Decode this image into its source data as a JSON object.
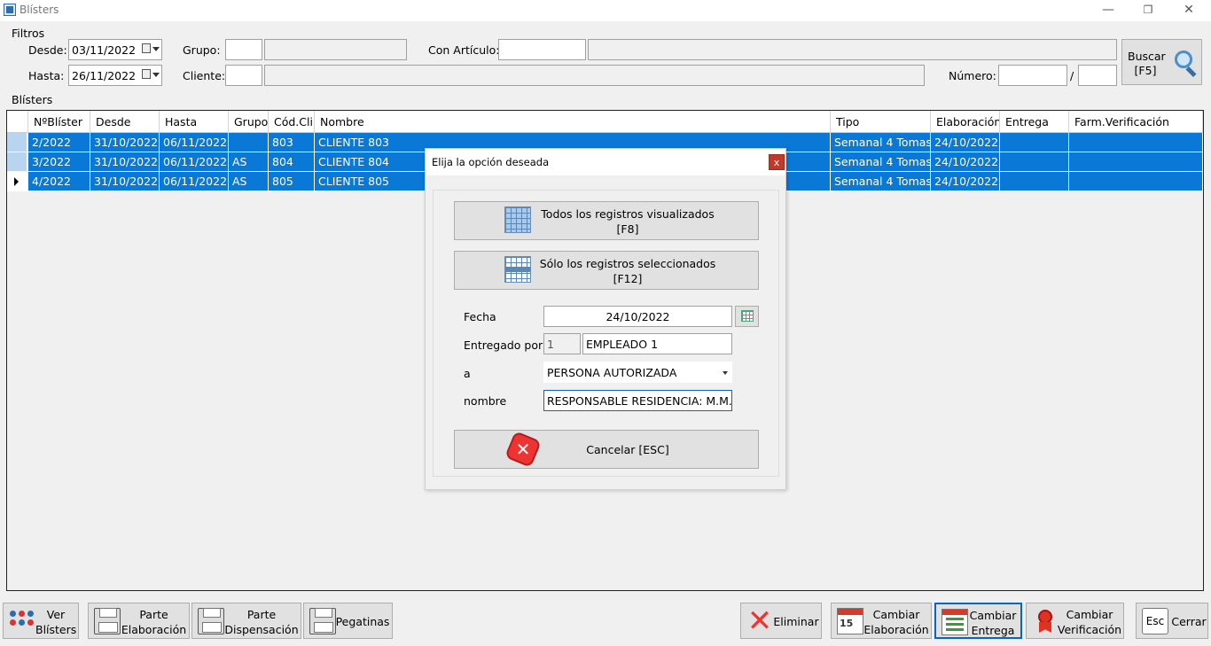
{
  "window": {
    "title": "Blísters",
    "minimize": "—",
    "restore": "❐",
    "close": "✕"
  },
  "filters": {
    "group_label": "Filtros",
    "desde_label": "Desde:",
    "desde_value": "03/11/2022",
    "hasta_label": "Hasta:",
    "hasta_value": "26/11/2022",
    "grupo_label": "Grupo:",
    "cliente_label": "Cliente:",
    "articulo_label": "Con Artículo:",
    "numero_label": "Número:",
    "numero_sep": "/",
    "search_line1": "Buscar",
    "search_line2": "[F5]"
  },
  "grid": {
    "group_label": "Blísters",
    "columns": [
      "NºBlíster",
      "Desde",
      "Hasta",
      "Grupo",
      "Cód.Cli.",
      "Nombre",
      "Tipo",
      "Elaboración",
      "Entrega",
      "Farm.Verificación"
    ],
    "rows": [
      {
        "num": "2/2022",
        "desde": "31/10/2022",
        "hasta": "06/11/2022",
        "grupo": "",
        "cod": "803",
        "nombre": "CLIENTE 803",
        "tipo": "Semanal 4 Tomas",
        "elab": "24/10/2022",
        "entrega": "",
        "farm": "",
        "current": false
      },
      {
        "num": "3/2022",
        "desde": "31/10/2022",
        "hasta": "06/11/2022",
        "grupo": "AS",
        "cod": "804",
        "nombre": "CLIENTE 804",
        "tipo": "Semanal 4 Tomas",
        "elab": "24/10/2022",
        "entrega": "",
        "farm": "",
        "current": false
      },
      {
        "num": "4/2022",
        "desde": "31/10/2022",
        "hasta": "06/11/2022",
        "grupo": "AS",
        "cod": "805",
        "nombre": "CLIENTE 805",
        "tipo": "Semanal 4 Tomas",
        "elab": "24/10/2022",
        "entrega": "",
        "farm": "",
        "current": true
      }
    ]
  },
  "dialog": {
    "title": "Elija la opción deseada",
    "close": "x",
    "all_line1": "Todos los registros visualizados",
    "all_line2": "[F8]",
    "sel_line1": "Sólo los registros seleccionados",
    "sel_line2": "[F12]",
    "fecha_label": "Fecha",
    "fecha_value": "24/10/2022",
    "entregado_label": "Entregado por",
    "entregado_code": "1",
    "entregado_name": "EMPLEADO 1",
    "a_label": "a",
    "a_value": "PERSONA AUTORIZADA",
    "nombre_label": "nombre",
    "nombre_value": "RESPONSABLE RESIDENCIA: M.M.R.",
    "cancel": "Cancelar [ESC]"
  },
  "toolbar": {
    "ver_l1": "Ver",
    "ver_l2": "Blísters",
    "pe_l1": "Parte",
    "pe_l2": "Elaboración",
    "pd_l1": "Parte",
    "pd_l2": "Dispensación",
    "pegatinas": "Pegatinas",
    "eliminar": "Eliminar",
    "ce_l1": "Cambiar",
    "ce_l2": "Elaboración",
    "cen_l1": "Cambiar",
    "cen_l2": "Entrega",
    "cv_l1": "Cambiar",
    "cv_l2": "Verificación",
    "esc_key": "Esc",
    "cerrar": "Cerrar"
  },
  "colors": {
    "selection": "#0a78d7",
    "focus_border": "#0a64c8"
  }
}
